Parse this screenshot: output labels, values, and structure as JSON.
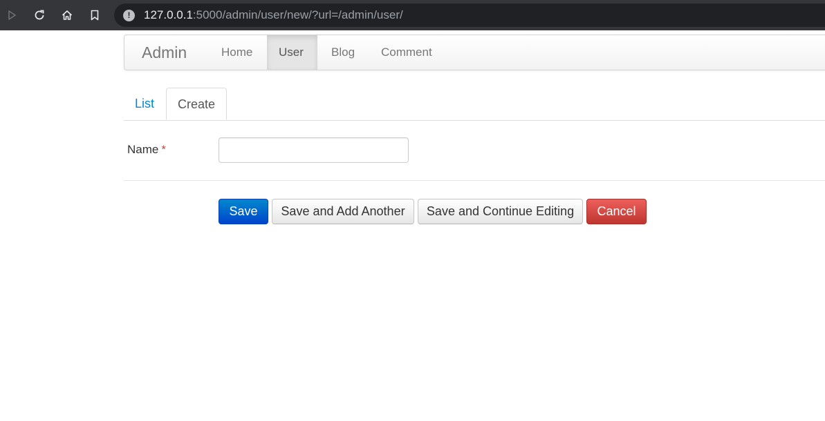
{
  "browser": {
    "url_host": "127.0.0.1",
    "url_rest": ":5000/admin/user/new/?url=/admin/user/",
    "info_icon": "!",
    "icons": [
      "play-icon",
      "reload-icon",
      "home-icon",
      "bookmark-icon",
      "info-icon"
    ]
  },
  "navbar": {
    "brand": "Admin",
    "items": [
      {
        "label": "Home",
        "active": false
      },
      {
        "label": "User",
        "active": true
      },
      {
        "label": "Blog",
        "active": false
      },
      {
        "label": "Comment",
        "active": false
      }
    ]
  },
  "tabs": [
    {
      "label": "List",
      "active": false
    },
    {
      "label": "Create",
      "active": true
    }
  ],
  "form": {
    "name_label": "Name",
    "required_mark": "*",
    "name_value": "",
    "name_placeholder": ""
  },
  "actions": {
    "save": "Save",
    "save_add_another": "Save and Add Another",
    "save_continue": "Save and Continue Editing",
    "cancel": "Cancel"
  },
  "colors": {
    "primary": "#0066cc",
    "danger": "#d9443e",
    "link": "#0088cc"
  }
}
